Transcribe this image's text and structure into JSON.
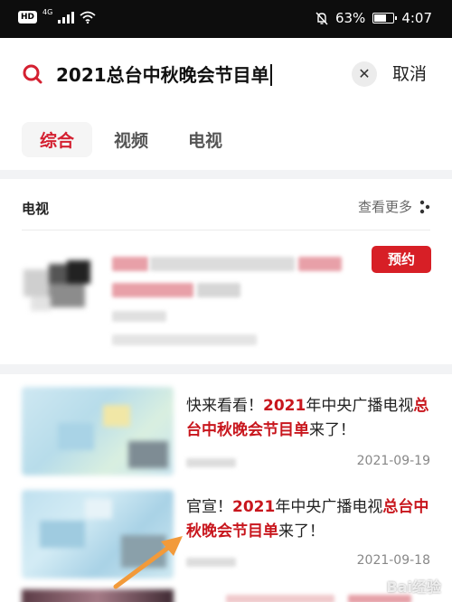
{
  "status_bar": {
    "hd_label": "HD",
    "network": "4G",
    "battery": "63%",
    "battery_fraction": 0.63,
    "time": "4:07"
  },
  "search": {
    "query": "2021总台中秋晚会节目单",
    "cancel_label": "取消"
  },
  "tabs": [
    {
      "label": "综合",
      "active": true
    },
    {
      "label": "视频",
      "active": false
    },
    {
      "label": "电视",
      "active": false
    }
  ],
  "tv_section": {
    "title": "电视",
    "more_label": "查看更多",
    "reserve_label": "预约"
  },
  "news": [
    {
      "title_parts": [
        {
          "text": "快来看看！",
          "highlight": false
        },
        {
          "text": "2021",
          "highlight": true
        },
        {
          "text": "年中央广播电视",
          "highlight": false
        },
        {
          "text": "总台中秋晚会节目单",
          "highlight": true
        },
        {
          "text": "来了！",
          "highlight": false
        }
      ],
      "date": "2021-09-19"
    },
    {
      "title_parts": [
        {
          "text": "官宣！",
          "highlight": false
        },
        {
          "text": "2021",
          "highlight": true
        },
        {
          "text": "年中央广播电视",
          "highlight": false
        },
        {
          "text": "总台中秋晚会节目单",
          "highlight": true
        },
        {
          "text": "来了！",
          "highlight": false
        }
      ],
      "date": "2021-09-18"
    }
  ],
  "colors": {
    "accent": "#d42031",
    "reserve_button": "#d71f26",
    "highlight_text": "#c8161d",
    "arrow": "#f29a3a"
  },
  "watermark": "Bai经验"
}
